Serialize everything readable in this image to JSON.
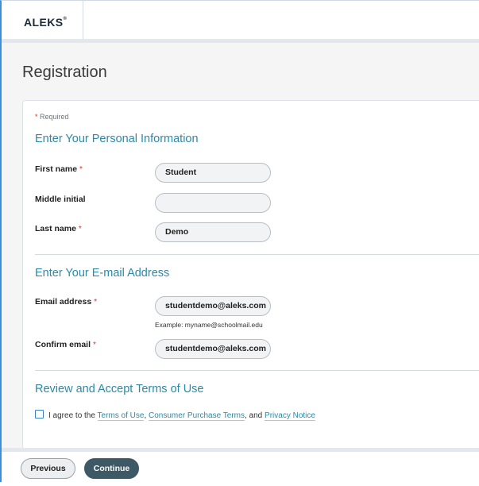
{
  "app": {
    "logo_text": "ALEKS",
    "logo_mark": "®"
  },
  "page": {
    "title": "Registration"
  },
  "form": {
    "required_note": "Required",
    "required_marker": "*",
    "personal": {
      "title": "Enter Your Personal Information",
      "first_name": {
        "label": "First name",
        "value": "Student"
      },
      "middle_initial": {
        "label": "Middle initial",
        "value": ""
      },
      "last_name": {
        "label": "Last name",
        "value": "Demo"
      }
    },
    "email": {
      "title": "Enter Your E-mail Address",
      "address": {
        "label": "Email address",
        "value": "studentdemo@aleks.com",
        "hint": "Example: myname@schoolmail.edu"
      },
      "confirm": {
        "label": "Confirm email",
        "value": "studentdemo@aleks.com"
      }
    },
    "terms": {
      "title": "Review and Accept Terms of Use",
      "agree_text": "I agree to the",
      "terms_link": "Terms of Use",
      "sep1": ",",
      "purchase_link": "Consumer Purchase Terms",
      "sep2": ", and",
      "privacy_link": "Privacy Notice",
      "checked": false
    }
  },
  "footer": {
    "previous_label": "Previous",
    "continue_label": "Continue"
  },
  "colors": {
    "accent": "#2a8aa8",
    "required": "#d9342b",
    "primary_button": "#3e5966",
    "frame": "#3c8fd8"
  }
}
